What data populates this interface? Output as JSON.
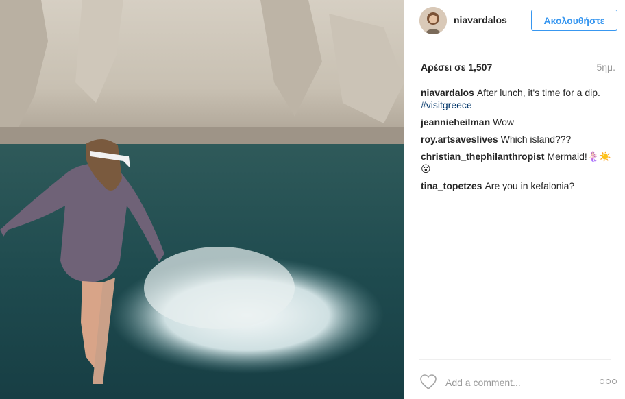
{
  "post": {
    "username": "niavardalos",
    "follow_label": "Ακολουθήστε",
    "likes_text": "Αρέσει σε 1,507",
    "age": "5ημ."
  },
  "comments": [
    {
      "user": "niavardalos",
      "text": "After lunch, it's time for a dip.",
      "hashtag": "#visitgreece"
    },
    {
      "user": "jeannieheilman",
      "text": "Wow"
    },
    {
      "user": "roy.artsaveslives",
      "text": "Which island???"
    },
    {
      "user": "christian_thephilanthropist",
      "text": "Mermaid!🧜🏻‍♀️☀️😮"
    },
    {
      "user": "tina_topetzes",
      "text": "Are you in kefalonia?"
    }
  ],
  "composer": {
    "placeholder": "Add a comment..."
  },
  "icons": {
    "like": "heart-icon",
    "more": "more-options-icon"
  }
}
